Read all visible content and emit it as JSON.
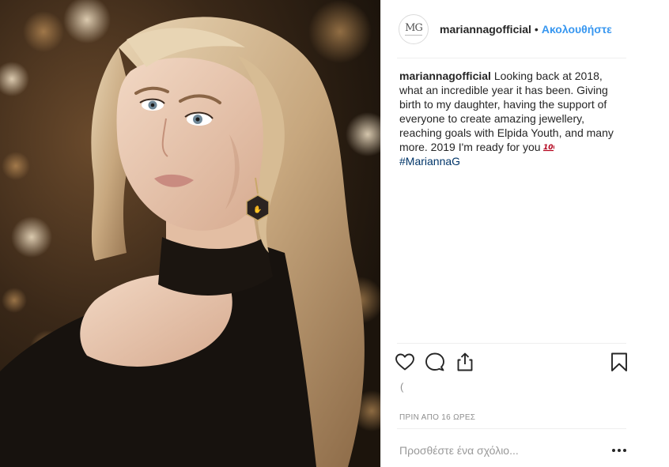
{
  "post": {
    "photo_alt": "portrait photo",
    "header": {
      "avatar_monogram": "MG",
      "username": "mariannagofficial",
      "separator": "•",
      "follow_label": "Ακολουθήστε"
    },
    "caption": {
      "username": "mariannagofficial",
      "text": "Looking back at 2018, what an incredible year it has been. Giving birth to my daughter, having the support of everyone to create amazing jewellery, reaching goals with Elpida Youth, and many more. 2019 I'm ready for you",
      "emoji_icon": "100-emoji-icon",
      "hashtag": "#MariannaG"
    },
    "actions": {
      "like_icon": "heart-icon",
      "comment_icon": "comment-bubble-icon",
      "share_icon": "share-icon",
      "save_icon": "bookmark-icon"
    },
    "loading_glyph": "(",
    "timestamp": "ΠΡΙΝ ΑΠΟ 16 ΩΡΕΣ",
    "comment": {
      "placeholder": "Προσθέστε ένα σχόλιο...",
      "value": "",
      "more_icon": "more-options-icon"
    },
    "colors": {
      "link_blue": "#3897f0",
      "hashtag": "#003569",
      "meta_gray": "#8e8e8e",
      "emoji_red": "#b3001b"
    }
  }
}
